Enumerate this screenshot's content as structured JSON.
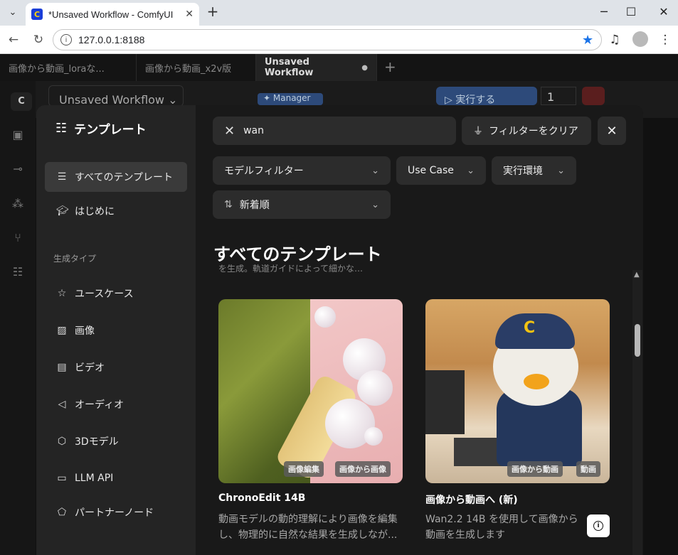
{
  "browser": {
    "tab_title": "*Unsaved Workflow - ComfyUI",
    "url": "127.0.0.1:8188"
  },
  "workflow_tabs": [
    "画像から動画_loraな...",
    "画像から動画_x2v版",
    "Unsaved Workflow"
  ],
  "toolbar": {
    "workflow_name": "Unsaved Workflow",
    "manager": "Manager",
    "run": "実行する",
    "batch_count": "1"
  },
  "modal": {
    "sidebar_title": "テンプレート",
    "nav": [
      {
        "label": "すべてのテンプレート",
        "icon": "list-icon"
      },
      {
        "label": "はじめに",
        "icon": "graduation-cap-icon"
      }
    ],
    "section_label": "生成タイプ",
    "types": [
      {
        "label": "ユースケース",
        "icon": "star-icon"
      },
      {
        "label": "画像",
        "icon": "image-icon"
      },
      {
        "label": "ビデオ",
        "icon": "film-icon"
      },
      {
        "label": "オーディオ",
        "icon": "speaker-icon"
      },
      {
        "label": "3Dモデル",
        "icon": "cube-icon"
      },
      {
        "label": "LLM API",
        "icon": "document-icon"
      },
      {
        "label": "パートナーノード",
        "icon": "handshake-icon"
      }
    ],
    "search_value": "wan",
    "clear_filters": "フィルターをクリア",
    "filters": {
      "model": "モデルフィルター",
      "use_case": "Use Case",
      "env": "実行環境",
      "sort": "新着順"
    },
    "heading": "すべてのテンプレート",
    "cut_text": "を生成。軌道ガイドによって細かな…",
    "cards": [
      {
        "title": "ChronoEdit 14B",
        "tags": [
          "画像編集",
          "画像から画像"
        ],
        "desc": "動画モデルの動的理解により画像を編集し、物理的に自然な結果を生成しなが..."
      },
      {
        "title": "画像から動画へ (新)",
        "tags": [
          "画像から動画",
          "動画"
        ],
        "desc": "Wan2.2 14B を使用して画像から動画を生成します"
      }
    ]
  }
}
